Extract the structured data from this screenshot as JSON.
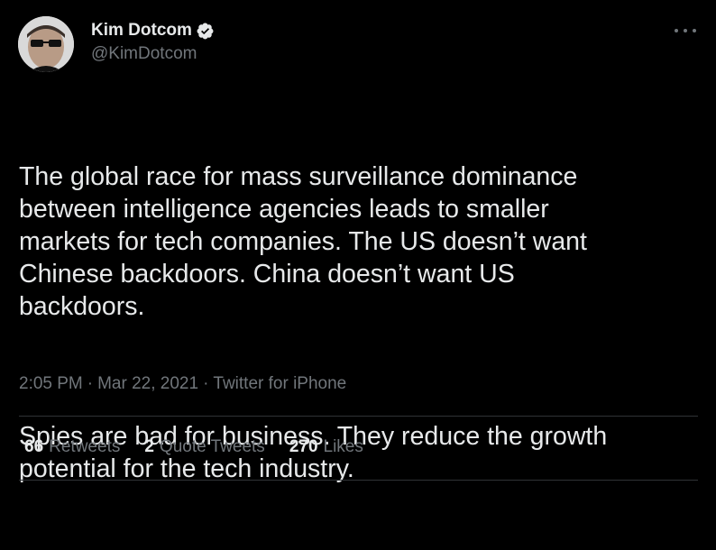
{
  "author": {
    "display_name": "Kim Dotcom",
    "handle": "@KimDotcom",
    "verified": true,
    "verified_icon": "verified-badge-icon"
  },
  "tweet": {
    "paragraphs": [
      "The global race for mass surveillance dominance\nbetween intelligence agencies leads to smaller\nmarkets for tech companies. The US doesn’t want\nChinese backdoors. China doesn’t want US\nbackdoors.",
      "Spies are bad for business. They reduce the growth\npotential for the tech industry."
    ],
    "time": "2:05 PM",
    "separator": "·",
    "date": "Mar 22, 2021",
    "source": "Twitter for iPhone"
  },
  "stats": {
    "retweets_count": "66",
    "retweets_label": "Retweets",
    "quotes_count": "2",
    "quotes_label": "Quote Tweets",
    "likes_count": "270",
    "likes_label": "Likes"
  },
  "colors": {
    "background": "#000000",
    "primary_text": "#e7e9ea",
    "secondary_text": "#71767b",
    "divider": "#2f3336"
  }
}
